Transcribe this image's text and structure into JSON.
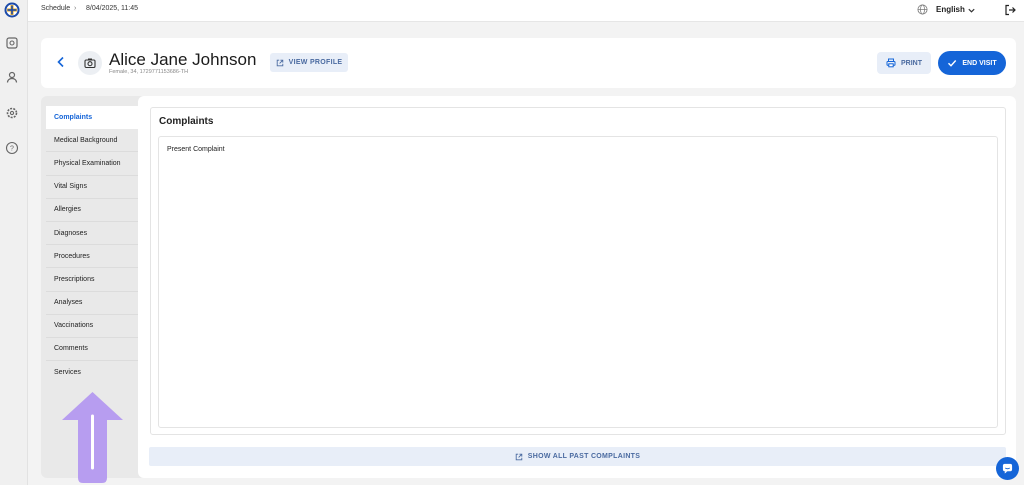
{
  "topbar": {
    "breadcrumb_root": "Schedule",
    "breadcrumb_separator": "›",
    "breadcrumb_current": "8/04/2025, 11:45",
    "language": "English"
  },
  "rail": {
    "icons": [
      "logo-icon",
      "calendar-icon",
      "user-icon",
      "settings-icon",
      "help-icon"
    ]
  },
  "patient": {
    "name": "Alice Jane Johnson",
    "details": "Female, 34, 1729771153686-TH"
  },
  "header": {
    "view_profile_label": "VIEW PROFILE",
    "print_label": "PRINT",
    "end_visit_label": "END VISIT"
  },
  "sidebar": {
    "items": [
      {
        "label": "Complaints"
      },
      {
        "label": "Medical Background"
      },
      {
        "label": "Physical Examination"
      },
      {
        "label": "Vital Signs"
      },
      {
        "label": "Allergies"
      },
      {
        "label": "Diagnoses"
      },
      {
        "label": "Procedures"
      },
      {
        "label": "Prescriptions"
      },
      {
        "label": "Analyses"
      },
      {
        "label": "Vaccinations"
      },
      {
        "label": "Comments"
      },
      {
        "label": "Services"
      }
    ],
    "active_index": 0
  },
  "complaints": {
    "title": "Complaints",
    "present_label": "Present Complaint",
    "show_all_label": "SHOW ALL PAST COMPLAINTS"
  },
  "colors": {
    "accent": "#1565d8",
    "annotation_arrow": "#b79df0"
  }
}
